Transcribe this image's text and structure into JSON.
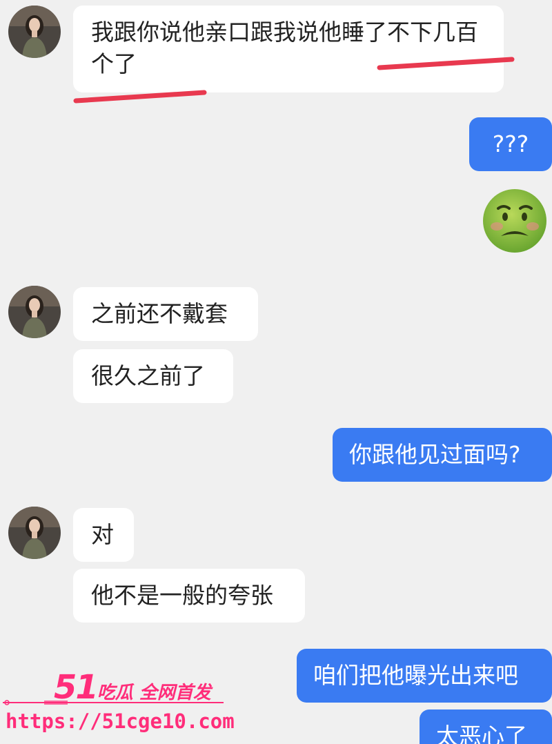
{
  "conversation": {
    "messages": [
      {
        "side": "incoming",
        "text": "我跟你说他亲口跟我说他睡了不下几百个了"
      },
      {
        "side": "outgoing",
        "text": "???"
      },
      {
        "side": "outgoing",
        "emoji": "nauseated-face"
      },
      {
        "side": "incoming",
        "text": "之前还不戴套"
      },
      {
        "side": "incoming",
        "text": "很久之前了"
      },
      {
        "side": "outgoing",
        "text": "你跟他见过面吗?"
      },
      {
        "side": "incoming",
        "text": "对"
      },
      {
        "side": "incoming",
        "text": "他不是一般的夸张"
      },
      {
        "side": "outgoing",
        "text": "咱们把他曝光出来吧"
      },
      {
        "side": "outgoing",
        "text": "太恶心了"
      }
    ]
  },
  "colors": {
    "background": "#f0f0f0",
    "incoming_bubble": "#ffffff",
    "outgoing_bubble": "#3a7bf2",
    "annotation_red": "#e8394f",
    "watermark": "#ff2d7a"
  },
  "watermark": {
    "brand_number": "51",
    "brand_text": "吃瓜 全网首发",
    "url": "https://51cge10.com"
  }
}
